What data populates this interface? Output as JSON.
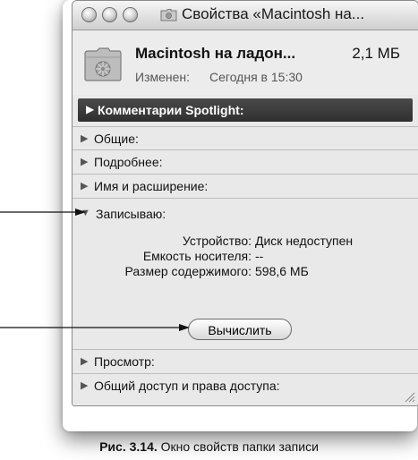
{
  "window": {
    "title": "Свойства «Macintosh на..."
  },
  "header": {
    "item_name": "Macintosh на ладон...",
    "item_size": "2,1 МБ",
    "modified_label": "Изменен:",
    "modified_value": "Сегодня в 15:30"
  },
  "sections": {
    "spotlight": "Комментарии Spotlight:",
    "general": "Общие:",
    "more_info": "Подробнее:",
    "name_extension": "Имя и расширение:",
    "burning": "Записываю:",
    "preview": "Просмотр:",
    "sharing": "Общий доступ и права доступа:"
  },
  "burn_info": {
    "rows": [
      {
        "key": "Устройство:",
        "value": "Диск недоступен"
      },
      {
        "key": "Емкость носителя:",
        "value": "--"
      },
      {
        "key": "Размер содержимого:",
        "value": "598,6 МБ"
      }
    ],
    "calculate_button": "Вычислить"
  },
  "caption": {
    "label": "Рис. 3.14.",
    "text": " Окно свойств папки записи"
  },
  "icons": {
    "disclosure_collapsed": "triangle-right",
    "disclosure_expanded": "triangle-down",
    "folder": "burn-folder-icon",
    "traffic_lights": "graphite-window-buttons"
  }
}
